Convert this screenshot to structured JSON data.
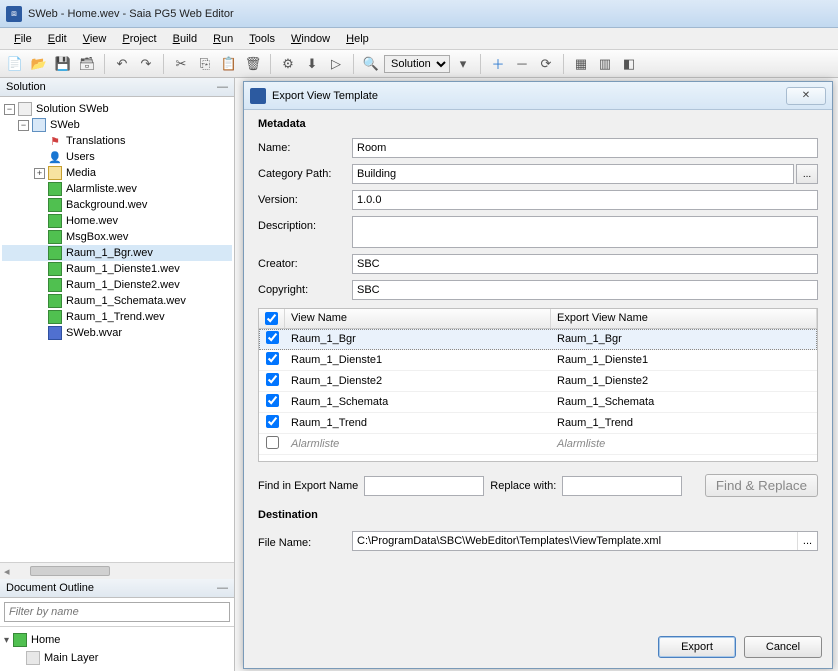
{
  "titlebar": {
    "text": "SWeb - Home.wev - Saia PG5 Web Editor"
  },
  "menubar": [
    "File",
    "Edit",
    "View",
    "Project",
    "Build",
    "Run",
    "Tools",
    "Window",
    "Help"
  ],
  "toolbar": {
    "config_label": "Solution"
  },
  "solution_panel": {
    "header": "Solution",
    "tree": {
      "root": "Solution SWeb",
      "project": "SWeb",
      "translations": "Translations",
      "users": "Users",
      "media": "Media",
      "files": [
        "Alarmliste.wev",
        "Background.wev",
        "Home.wev",
        "MsgBox.wev",
        "Raum_1_Bgr.wev",
        "Raum_1_Dienste1.wev",
        "Raum_1_Dienste2.wev",
        "Raum_1_Schemata.wev",
        "Raum_1_Trend.wev",
        "SWeb.wvar"
      ]
    }
  },
  "outline": {
    "header": "Document Outline",
    "filter_placeholder": "Filter by name",
    "root": "Home",
    "child": "Main Layer"
  },
  "dialog": {
    "title": "Export View Template",
    "sections": {
      "metadata": "Metadata",
      "destination": "Destination"
    },
    "labels": {
      "name": "Name:",
      "category_path": "Category Path:",
      "version": "Version:",
      "description": "Description:",
      "creator": "Creator:",
      "copyright": "Copyright:",
      "view_name": "View Name",
      "export_view_name": "Export View Name",
      "find": "Find in Export Name",
      "replace": "Replace with:",
      "find_replace": "Find & Replace",
      "file_name": "File Name:"
    },
    "values": {
      "name": "Room",
      "category_path": "Building",
      "version": "1.0.0",
      "description": "",
      "creator": "SBC",
      "copyright": "SBC",
      "file_name": "C:\\ProgramData\\SBC\\WebEditor\\Templates\\ViewTemplate.xml"
    },
    "views": [
      {
        "checked": true,
        "name": "Raum_1_Bgr",
        "export": "Raum_1_Bgr",
        "selected": true
      },
      {
        "checked": true,
        "name": "Raum_1_Dienste1",
        "export": "Raum_1_Dienste1",
        "selected": false
      },
      {
        "checked": true,
        "name": "Raum_1_Dienste2",
        "export": "Raum_1_Dienste2",
        "selected": false
      },
      {
        "checked": true,
        "name": "Raum_1_Schemata",
        "export": "Raum_1_Schemata",
        "selected": false
      },
      {
        "checked": true,
        "name": "Raum_1_Trend",
        "export": "Raum_1_Trend",
        "selected": false
      },
      {
        "checked": false,
        "name": "Alarmliste",
        "export": "Alarmliste",
        "selected": false
      }
    ],
    "buttons": {
      "export": "Export",
      "cancel": "Cancel"
    }
  }
}
